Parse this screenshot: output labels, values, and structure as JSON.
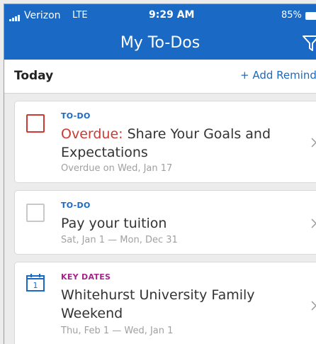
{
  "status_bar": {
    "carrier": "Verizon",
    "network": "LTE",
    "time": "9:29 AM",
    "battery": "85%"
  },
  "header": {
    "title": "My To-Dos"
  },
  "section": {
    "title": "Today",
    "add_label": "+ Add Reminde"
  },
  "items": [
    {
      "type": "TO-DO",
      "overdue_prefix": "Overdue:",
      "name": "Share Your Goals and Expectations",
      "subtitle": "Overdue on Wed, Jan 17"
    },
    {
      "type": "TO-DO",
      "name": "Pay your tuition",
      "subtitle": "Sat, Jan 1 — Mon, Dec 31"
    },
    {
      "type": "KEY DATES",
      "name": "Whitehurst University Family Weekend",
      "subtitle": "Thu, Feb 1 — Wed, Jan 1",
      "calendar_day": "1"
    }
  ],
  "colors": {
    "brand": "#1a69c4",
    "overdue": "#cc3a33",
    "key_dates": "#a4248c"
  },
  "icons": [
    "signal-icon",
    "battery-icon",
    "filter-icon",
    "checkbox-icon",
    "calendar-icon",
    "chevron-right-icon"
  ]
}
